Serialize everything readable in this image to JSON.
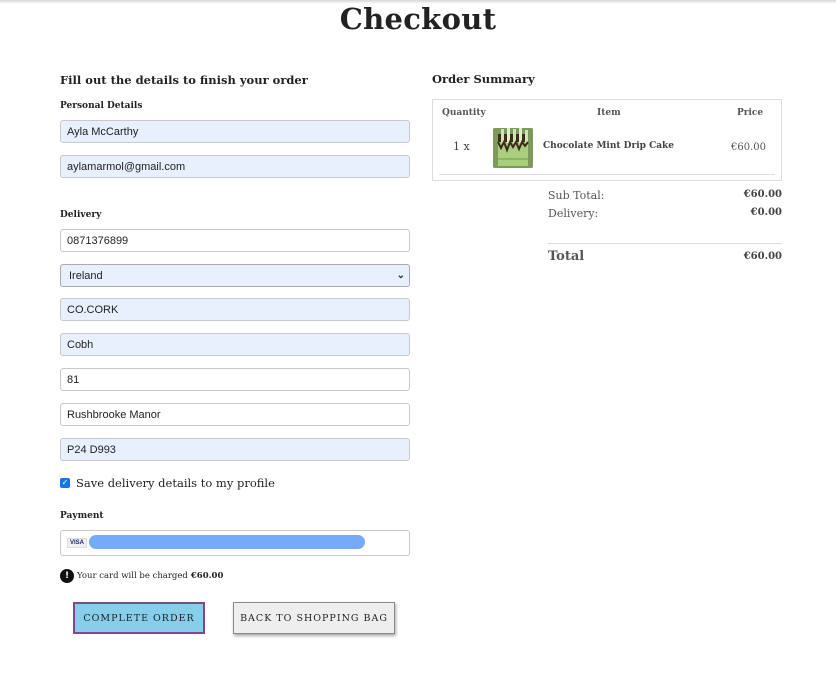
{
  "page": {
    "title": "Checkout"
  },
  "form": {
    "section_title": "Fill out the details to finish your order",
    "personal": {
      "label": "Personal Details",
      "full_name": "Ayla McCarthy",
      "email": "aylamarmol@gmail.com"
    },
    "delivery": {
      "label": "Delivery",
      "phone": "0871376899",
      "country": "Ireland",
      "county": "CO.CORK",
      "town": "Cobh",
      "street1": "81",
      "street2": "Rushbrooke Manor",
      "postcode": "P24 D993"
    },
    "save_info_label": "Save delivery details to my profile",
    "save_info_checked": true,
    "payment": {
      "label": "Payment",
      "card_brand": "VISA",
      "charge_text": "Your card will be charged",
      "charge_amount": "€60.00"
    }
  },
  "buttons": {
    "complete": "COMPLETE ORDER",
    "back": "BACK TO SHOPPING BAG"
  },
  "summary": {
    "title": "Order Summary",
    "headers": {
      "quantity": "Quantity",
      "item": "Item",
      "price": "Price"
    },
    "items": [
      {
        "quantity": "1 x",
        "name": "Chocolate Mint Drip Cake",
        "price": "€60.00"
      }
    ],
    "subtotal_label": "Sub Total:",
    "subtotal_value": "€60.00",
    "delivery_label": "Delivery:",
    "delivery_value": "€0.00",
    "total_label": "Total",
    "total_value": "€60.00"
  },
  "colors": {
    "complete_button_bg": "#87ceeb",
    "complete_button_border": "#7a4a8a",
    "autofill_bg": "#e8f0fe",
    "redaction": "#6ea6f5"
  }
}
